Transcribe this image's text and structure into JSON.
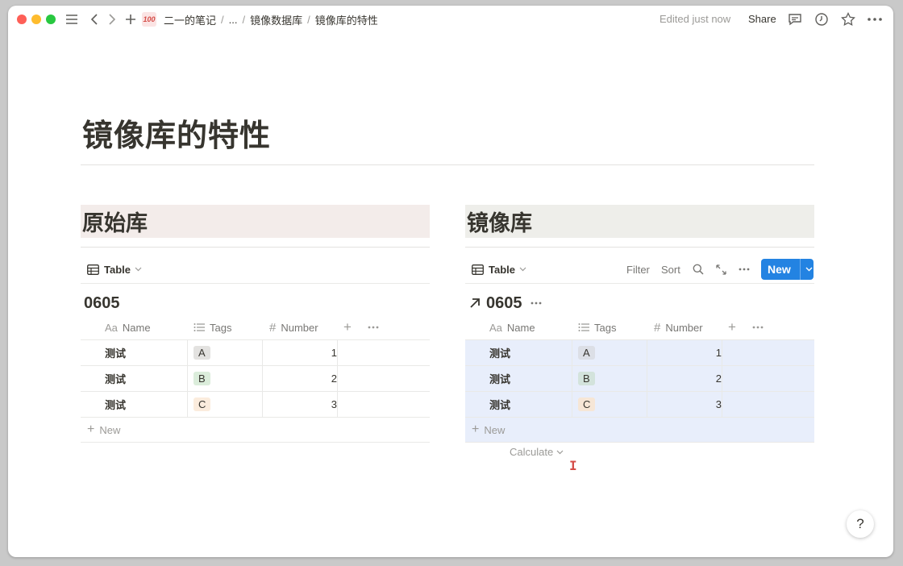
{
  "colors": {
    "brand_blue": "#2383e2",
    "mirror_highlight": "#e8eefb",
    "heading_bg_left": "#f3ecea",
    "heading_bg_right": "#eeeeea",
    "tag_a": "#e3e2e0",
    "tag_b": "#dbeddb",
    "tag_c": "#fbecdd"
  },
  "topbar": {
    "breadcrumbs": [
      "二一的笔记",
      "...",
      "镜像数据库",
      "镜像库的特性"
    ],
    "badge_icon": "100-emoji-icon",
    "edited": "Edited just now",
    "share": "Share"
  },
  "page": {
    "title": "镜像库的特性"
  },
  "left": {
    "heading": "原始库",
    "view_label": "Table",
    "db_title": "0605",
    "columns": {
      "name": "Name",
      "tags": "Tags",
      "number": "Number",
      "name_prefix": "Aa"
    },
    "rows": [
      {
        "name": "测试",
        "tag": "A",
        "number": "1"
      },
      {
        "name": "测试",
        "tag": "B",
        "number": "2"
      },
      {
        "name": "测试",
        "tag": "C",
        "number": "3"
      }
    ],
    "new_label": "New"
  },
  "right": {
    "heading": "镜像库",
    "view_label": "Table",
    "filter": "Filter",
    "sort": "Sort",
    "new_button": "New",
    "db_title": "0605",
    "columns": {
      "name": "Name",
      "tags": "Tags",
      "number": "Number",
      "name_prefix": "Aa"
    },
    "rows": [
      {
        "name": "测试",
        "tag": "A",
        "number": "1"
      },
      {
        "name": "测试",
        "tag": "B",
        "number": "2"
      },
      {
        "name": "测试",
        "tag": "C",
        "number": "3"
      }
    ],
    "new_label": "New",
    "calculate": "Calculate"
  },
  "help_label": "?"
}
